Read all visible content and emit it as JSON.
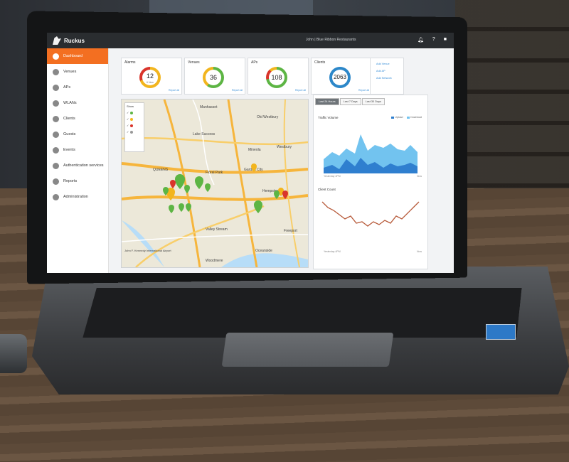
{
  "app": {
    "brand": "Ruckus",
    "user": "John  |  Blue Ribbon Restaurants"
  },
  "sidebar": {
    "items": [
      {
        "label": "Dashboard",
        "icon": "dashboard-icon",
        "active": true
      },
      {
        "label": "Venues",
        "icon": "location-pin-icon"
      },
      {
        "label": "APs",
        "icon": "access-point-icon"
      },
      {
        "label": "WLANs",
        "icon": "wifi-icon"
      },
      {
        "label": "Clients",
        "icon": "device-icon"
      },
      {
        "label": "Guests",
        "icon": "person-icon"
      },
      {
        "label": "Events",
        "icon": "flag-icon"
      },
      {
        "label": "Authentication services",
        "icon": "gear-icon"
      },
      {
        "label": "Reports",
        "icon": "pie-chart-icon"
      },
      {
        "label": "Administration",
        "icon": "wrench-icon"
      }
    ]
  },
  "summary": {
    "alarms": {
      "title": "Alarms",
      "value": "12",
      "sub": "6 New",
      "link": "Report all"
    },
    "venues": {
      "title": "Venues",
      "value": "36",
      "link": "Report all"
    },
    "aps": {
      "title": "APs",
      "value": "108",
      "link": "Report all"
    },
    "clients": {
      "title": "Clients",
      "value": "2063",
      "link": "Report all"
    }
  },
  "actions": {
    "add_venue": "Add Venue",
    "add_ap": "Add AP",
    "add_network": "Add Network"
  },
  "map": {
    "legend_title": "Show",
    "places": [
      "Manhasset",
      "Old Westbury",
      "Lake Success",
      "Mineola",
      "Westbury",
      "QUEENS",
      "Floral Park",
      "Garden City",
      "Hempstead",
      "Valley Stream",
      "Freeport",
      "Oceanside",
      "John F. Kennedy International Airport",
      "Woodmere"
    ]
  },
  "charts": {
    "tabs": [
      "Last 24 Hours",
      "Last 7 Days",
      "Last 30 Days"
    ],
    "traffic_title": "Traffic Volume",
    "traffic_legend": [
      "Upload",
      "Download"
    ],
    "clients_title": "Client Count",
    "start_label": "Yesterday 4PM",
    "end_label": "Now"
  },
  "colors": {
    "accent": "#f36f21",
    "topbar": "#2a2d30",
    "ring_green": "#5db544",
    "ring_yellow": "#f2b51e",
    "ring_red": "#d9342b",
    "ring_blue": "#2c87c9",
    "area_dark": "#2f7fcf",
    "area_light": "#72c3ef",
    "line_client": "#b75a3a"
  }
}
